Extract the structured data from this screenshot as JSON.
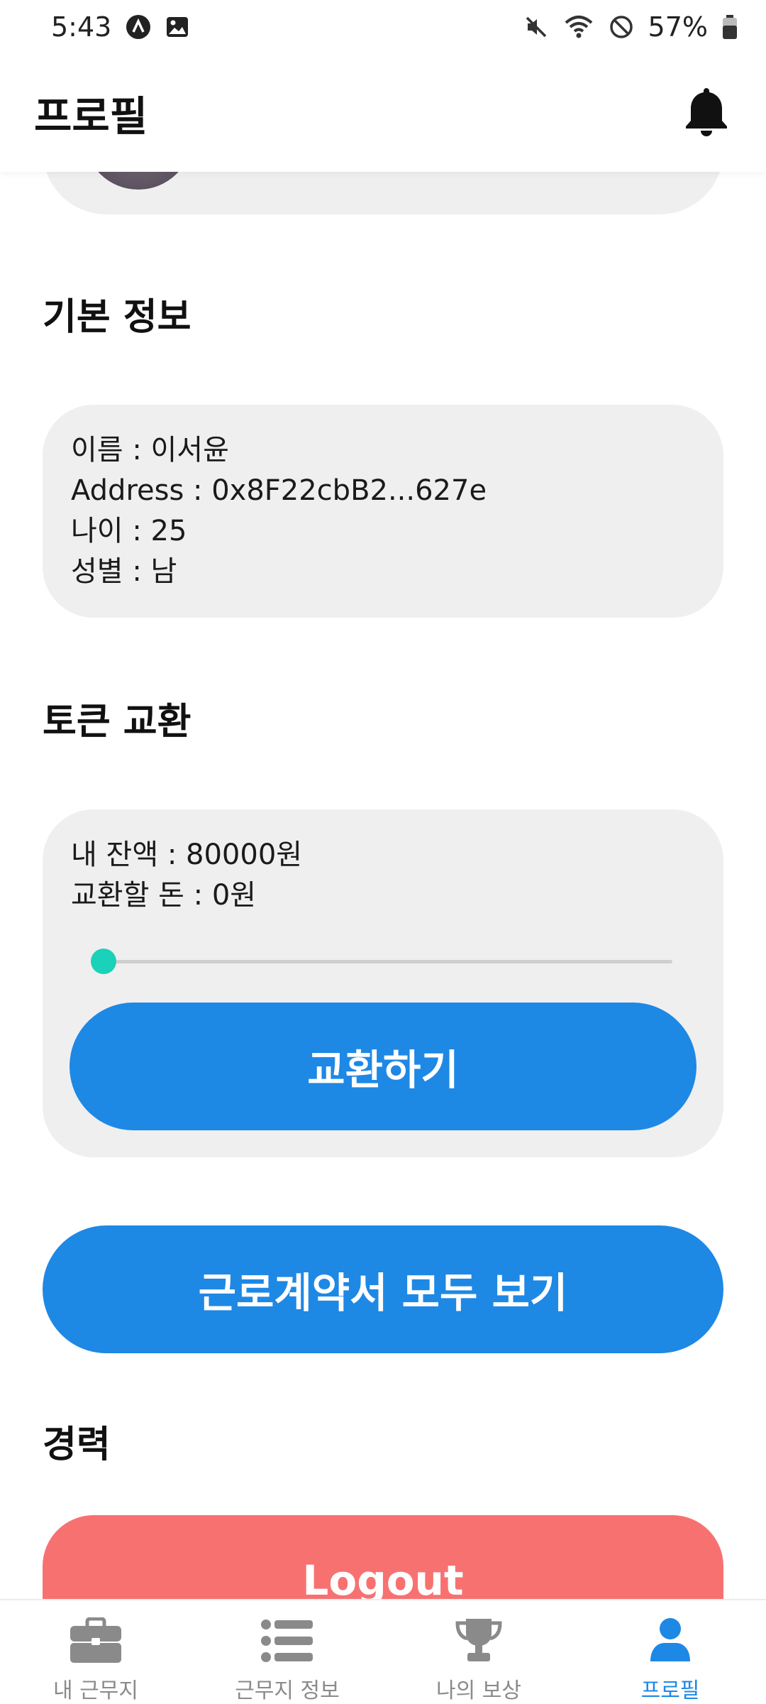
{
  "status_bar": {
    "time": "5:43",
    "battery_percent": "57%",
    "icons_left": [
      "a-circle-icon",
      "image-icon"
    ],
    "icons_right": [
      "mute-icon",
      "wifi-icon",
      "do-not-disturb-icon",
      "battery-icon"
    ]
  },
  "header": {
    "title": "프로필",
    "notification_icon": "bell-icon"
  },
  "basic_info": {
    "section_title": "기본 정보",
    "name_line": "이름 : 이서윤",
    "address_line": "Address : 0x8F22cbB2...627e",
    "age_line": "나이 : 25",
    "gender_line": "성별 : 남"
  },
  "token_exchange": {
    "section_title": "토큰 교환",
    "balance_line": "내 잔액 : 80000원",
    "exchange_amount_line": "교환할 돈 : 0원",
    "slider_value_fraction": 0,
    "exchange_button": "교환하기"
  },
  "contracts_button": "근로계약서 모두 보기",
  "career": {
    "section_title": "경력"
  },
  "logout_button": "Logout",
  "bottom_nav": {
    "items": [
      {
        "label": "내 근무지",
        "icon": "briefcase-icon",
        "active": false
      },
      {
        "label": "근무지 정보",
        "icon": "list-icon",
        "active": false
      },
      {
        "label": "나의 보상",
        "icon": "trophy-icon",
        "active": false
      },
      {
        "label": "프로필",
        "icon": "user-icon",
        "active": true
      }
    ]
  },
  "colors": {
    "accent": "#1e88e5",
    "logout": "#f87171",
    "slider_thumb": "#1ad1b9",
    "card_bg": "#efefef"
  }
}
